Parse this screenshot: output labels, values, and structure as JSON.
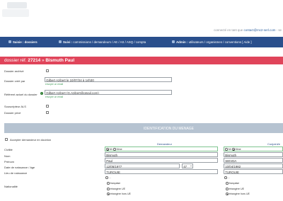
{
  "header": {
    "connected_text": "connecté en tant que",
    "connected_email": "contact@mc2-serl.com",
    "connected_tail": "- se"
  },
  "nav": {
    "items": [
      {
        "bold": "Saisie : dossiers",
        "rest": ""
      },
      {
        "bold": "Suivi :",
        "rest": "commissions / demandeurs / AE / AS / ASQ / compta"
      },
      {
        "bold": "Admin :",
        "rest": "utilisateurs / organismes / conventions  [ Aide ]"
      }
    ]
  },
  "title": {
    "prefix": "dossier réf.",
    "ref": "27214",
    "separator": "»",
    "name": "Bismuth Paul"
  },
  "form": {
    "archive_label": "Dossier archivé",
    "cree_par_label": "Dossier créé par",
    "cree_par_value": "Gilbert Azibert le 10/07/24 à 14h30",
    "cree_par_hint": "envoyer un email",
    "referent_label": "Référent actuel du dossier",
    "referent_value": "Gilbert Azibert (G.Azibert@gmail.com)",
    "referent_hint": "envoyer un email",
    "als_label": "Souscripteur ALS",
    "prive_label": "Dossier privé"
  },
  "section": {
    "title": "IDENTIFICATION DU MENAGE"
  },
  "menage": {
    "accepter_label": "Accepter demandeur en doublon",
    "col_demandeur": "Demandeur",
    "col_conjoint": "Conjoint/e",
    "civilite_label": "Civilité",
    "civ_options_a": [
      "Mr",
      "Mme"
    ],
    "civ_options_b": [
      "Mr",
      "Mme"
    ],
    "nom_label": "Nom",
    "nom_a": "Bismuth",
    "nom_b": "Bismuth",
    "prenom_label": "Prénom",
    "prenom_a": "Paul",
    "prenom_b": "SIEVDA",
    "naissance_label": "Date de naissance / âge",
    "naissance_a": "12/05/1977",
    "age_a": "47",
    "naissance_b": "10/04/1982",
    "lieu_label": "Lieu de naissance",
    "lieu_a": "TURQUIE",
    "lieu_b": "TURQUIE",
    "nationalite_label": "Nationalité",
    "nat_empty": "...",
    "nat_options": [
      "française",
      "étrangère UE",
      "étrangère hors UE"
    ]
  },
  "colors": {
    "nav": "#2a4f8c",
    "title_bar": "#e0445a",
    "section": "#b6c3d1",
    "hint": "#3e9a57"
  }
}
